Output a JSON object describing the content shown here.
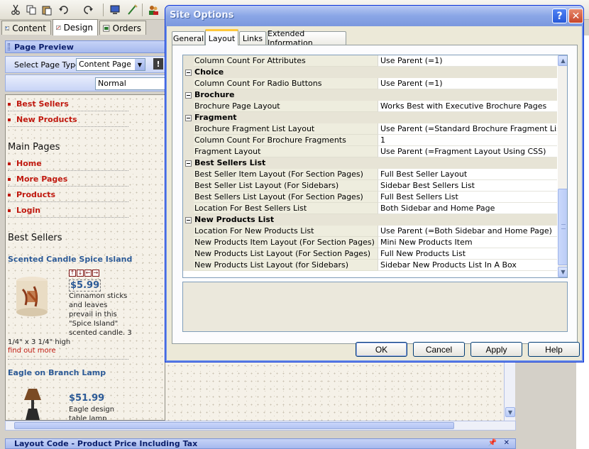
{
  "app": {
    "tabs": [
      {
        "label": "Content"
      },
      {
        "label": "Design"
      },
      {
        "label": "Orders"
      }
    ],
    "panel_title": "Page Preview",
    "select_page_type_label": "Select Page Type",
    "page_type_value": "Content Page",
    "style_value": "Normal",
    "bottom_panel_title": "Layout Code  - Product Price Including Tax"
  },
  "preview": {
    "nav_top": [
      "Best Sellers",
      "New Products"
    ],
    "main_pages_title": "Main Pages",
    "main_pages": [
      "Home",
      "More Pages",
      "Products",
      "Login"
    ],
    "best_sellers_title": "Best Sellers",
    "product1": {
      "name": "Scented Candle Spice Island",
      "price": "$5.99",
      "desc": [
        "Cinnamon sticks",
        "and leaves",
        "prevail in this",
        "\"Spice Island\"",
        "scented candle. 3"
      ],
      "desc_cont": "1/4\" x 3 1/4\" high",
      "more": "find out more"
    },
    "product2": {
      "name": "Eagle on Branch Lamp",
      "price": "$51.99",
      "desc": [
        "Eagle design",
        "table lamp"
      ]
    }
  },
  "dialog": {
    "title": "Site Options",
    "tabs": [
      "General",
      "Layout",
      "Links",
      "Extended Information"
    ],
    "active_tab": "Layout",
    "rows": [
      {
        "type": "prop",
        "name": "Column Count For Attributes",
        "value": "Use Parent (=1)"
      },
      {
        "type": "cat",
        "name": "Choice"
      },
      {
        "type": "prop",
        "name": "Column Count For Radio Buttons",
        "value": "Use Parent (=1)"
      },
      {
        "type": "cat",
        "name": "Brochure"
      },
      {
        "type": "prop",
        "name": "Brochure Page Layout",
        "value": "Works Best with Executive Brochure Pages"
      },
      {
        "type": "cat",
        "name": "Fragment"
      },
      {
        "type": "prop",
        "name": "Brochure Fragment List Layout",
        "value": "Use Parent (=Standard Brochure Fragment List)"
      },
      {
        "type": "prop",
        "name": "Column Count For Brochure Fragments",
        "value": "1"
      },
      {
        "type": "prop",
        "name": "Fragment Layout",
        "value": "Use Parent (=Fragment Layout Using CSS)"
      },
      {
        "type": "cat",
        "name": "Best Sellers List"
      },
      {
        "type": "prop",
        "name": "Best Seller Item Layout (For Section Pages)",
        "value": "Full Best Seller Layout"
      },
      {
        "type": "prop",
        "name": "Best Seller List Layout (For Sidebars)",
        "value": "Sidebar Best Sellers List"
      },
      {
        "type": "prop",
        "name": "Best Sellers List Layout (For Section Pages)",
        "value": "Full Best Sellers List"
      },
      {
        "type": "prop",
        "name": "Location For Best Sellers List",
        "value": "Both Sidebar and Home Page"
      },
      {
        "type": "cat",
        "name": "New Products List"
      },
      {
        "type": "prop",
        "name": "Location For New Products List",
        "value": "Use Parent (=Both Sidebar and Home Page)"
      },
      {
        "type": "prop",
        "name": "New Products Item Layout (For Section Pages)",
        "value": "Mini New Products Item"
      },
      {
        "type": "prop",
        "name": "New Products List Layout (For Section Pages)",
        "value": "Full New Products List"
      },
      {
        "type": "prop",
        "name": "New Products List Layout (for Sidebars)",
        "value": "Sidebar New Products List In A Box"
      }
    ],
    "buttons": {
      "ok": "OK",
      "cancel": "Cancel",
      "apply": "Apply",
      "help": "Help"
    }
  },
  "colors": {
    "accent_red": "#c0180e",
    "link_blue": "#2c5a96",
    "dialog_border": "#0831d9"
  }
}
